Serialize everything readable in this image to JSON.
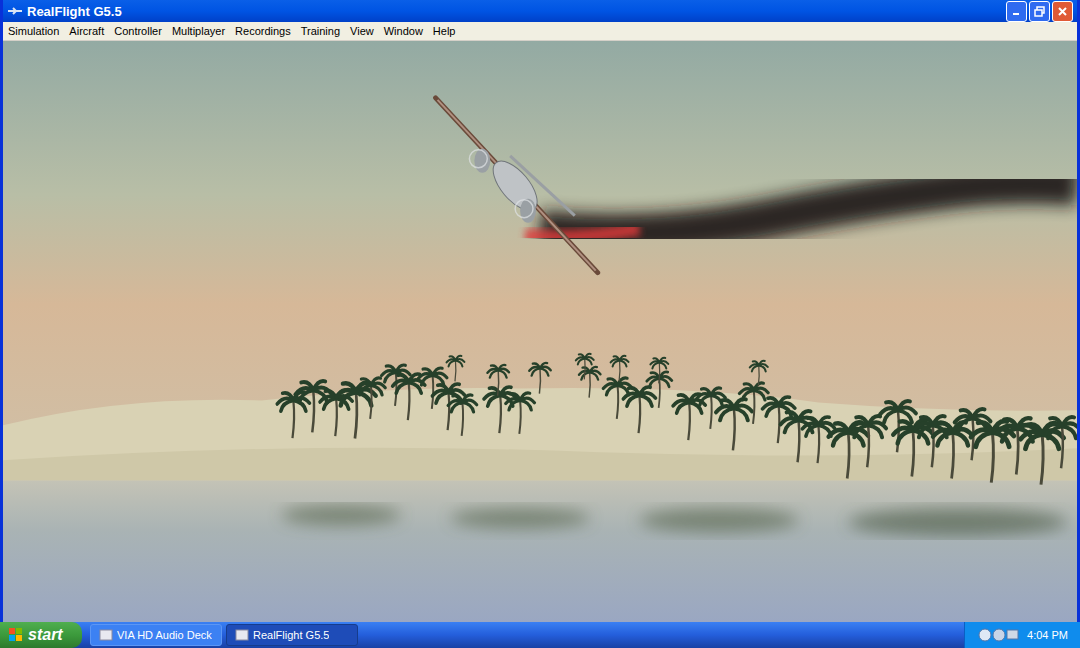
{
  "window": {
    "title": "RealFlight G5.5"
  },
  "menu": [
    "Simulation",
    "Aircraft",
    "Controller",
    "Multiplayer",
    "Recordings",
    "Training",
    "View",
    "Window",
    "Help"
  ],
  "taskbar": {
    "start": "start",
    "tasks": [
      {
        "label": "VIA HD Audio Deck",
        "selected": false
      },
      {
        "label": "RealFlight G5.5",
        "selected": true
      }
    ],
    "clock": "4:04 PM"
  }
}
